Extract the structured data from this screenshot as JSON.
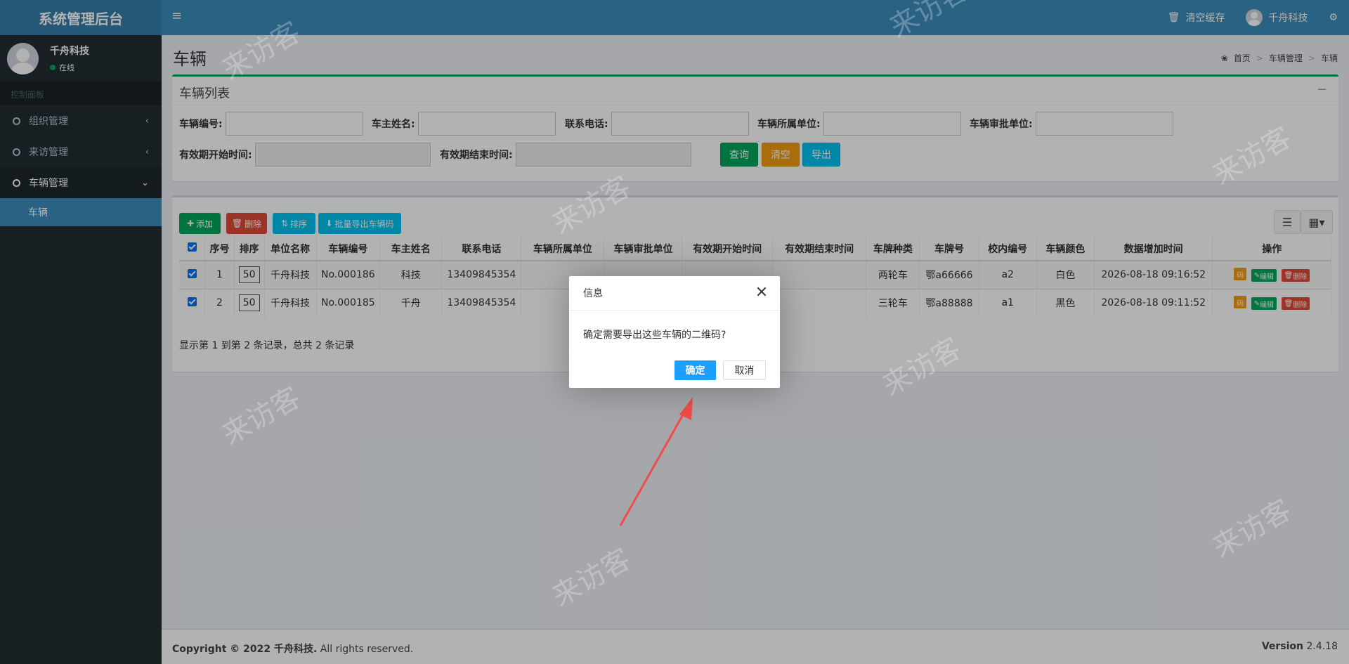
{
  "app": {
    "title": "系统管理后台"
  },
  "topbar": {
    "clear_cache": "清空缓存",
    "user": "千舟科技"
  },
  "sidebar": {
    "user_name": "千舟科技",
    "status": "在线",
    "menu_header": "控制面板",
    "items": [
      {
        "label": "组织管理"
      },
      {
        "label": "来访管理"
      },
      {
        "label": "车辆管理"
      }
    ],
    "sub_item": "车辆"
  },
  "page": {
    "title": "车辆",
    "breadcrumb": [
      "首页",
      "车辆管理",
      "车辆"
    ]
  },
  "search": {
    "title": "车辆列表",
    "fields": [
      "车辆编号:",
      "车主姓名:",
      "联系电话:",
      "车辆所属单位:",
      "车辆审批单位:",
      "有效期开始时间:",
      "有效期结束时间:"
    ],
    "query": "查询",
    "clear": "清空",
    "export": "导出"
  },
  "toolbar": {
    "add": "添加",
    "delete": "删除",
    "sort": "排序",
    "batch_export": "批量导出车辆码"
  },
  "table": {
    "headers": [
      "序号",
      "排序",
      "单位名称",
      "车辆编号",
      "车主姓名",
      "联系电话",
      "车辆所属单位",
      "车辆审批单位",
      "有效期开始时间",
      "有效期结束时间",
      "车牌种类",
      "车牌号",
      "校内编号",
      "车辆颜色",
      "数据增加时间",
      "操作"
    ],
    "rows": [
      [
        "1",
        "50",
        "千舟科技",
        "No.000186",
        "科技",
        "13409845354",
        "",
        "",
        "",
        "",
        "两轮车",
        "鄂a66666",
        "a2",
        "白色",
        "2026-08-18 09:16:52"
      ],
      [
        "2",
        "50",
        "千舟科技",
        "No.000185",
        "千舟",
        "13409845354",
        "",
        "",
        "",
        "",
        "三轮车",
        "鄂a88888",
        "a1",
        "黑色",
        "2026-08-18 09:11:52"
      ]
    ],
    "ops": {
      "code": "码",
      "edit": "编辑",
      "delete": "删除"
    },
    "pagination": "显示第 1 到第 2 条记录，总共 2 条记录"
  },
  "footer": {
    "copyright_bold": "Copyright © 2022 千舟科技.",
    "copyright_rest": " All rights reserved.",
    "version_label": "Version",
    "version": " 2.4.18"
  },
  "dialog": {
    "title": "信息",
    "message": "确定需要导出这些车辆的二维码?",
    "ok": "确定",
    "cancel": "取消"
  },
  "watermark": "来访客",
  "colors": {
    "header": "#3c8dbc",
    "sidebar": "#222d32",
    "success": "#00a65a",
    "warning": "#f39c12",
    "info": "#00c0ef",
    "danger": "#dd4b39",
    "dialog_ok": "#1e9fff"
  }
}
